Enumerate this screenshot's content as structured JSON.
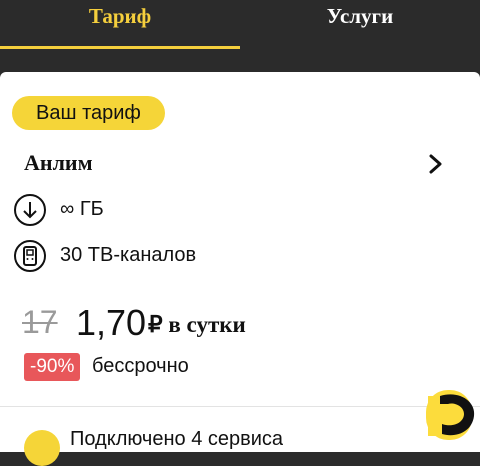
{
  "tabs": [
    {
      "label": "Тариф",
      "active": true
    },
    {
      "label": "Услуги",
      "active": false
    }
  ],
  "tariff": {
    "badge": "Ваш тариф",
    "name": "Анлим",
    "features": [
      {
        "icon": "download-arrow-icon",
        "text": "∞ ГБ"
      },
      {
        "icon": "tv-set-top-box-icon",
        "text": "30 ТВ-каналов"
      }
    ],
    "old_price": "17",
    "new_price": "1,70",
    "price_suffix": "₽ в сутки",
    "discount": "-90%",
    "discount_term": "бессрочно"
  },
  "next_item": {
    "text": "Подключено 4 сервиса"
  },
  "colors": {
    "accent": "#f5cf3d",
    "dark_bg": "#2b2b2b",
    "discount_bg": "#e8575a",
    "old_price": "#9a9a9a"
  }
}
